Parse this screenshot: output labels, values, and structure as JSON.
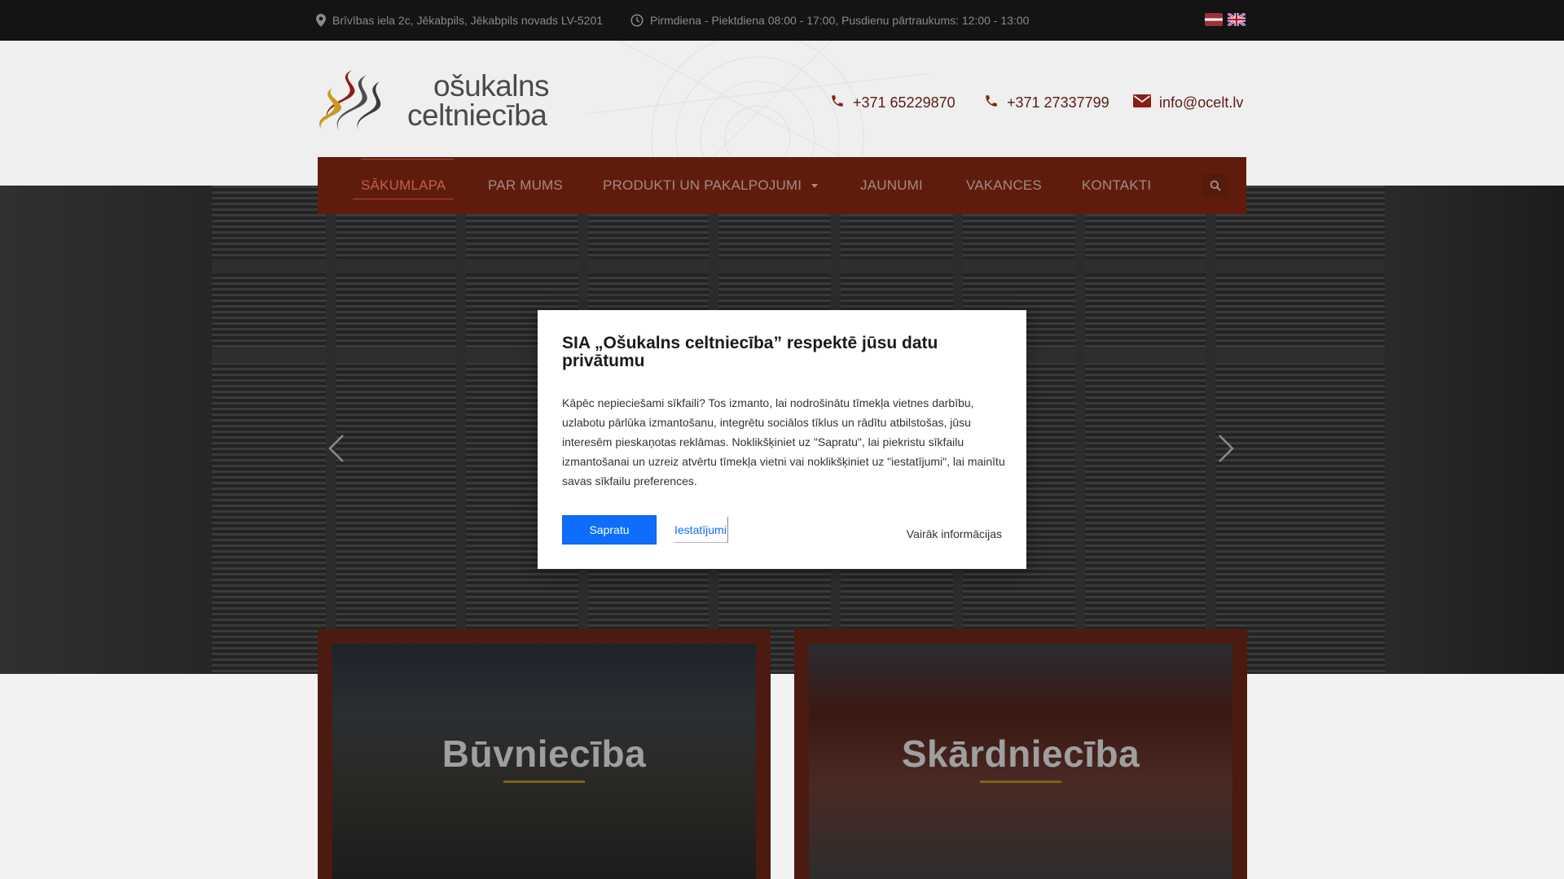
{
  "topbar": {
    "address": "Brīvības iela 2c, Jēkabpils, Jēkabpils novads LV-5201",
    "hours": "Pirmdiena - Piektdiena 08:00 - 17:00, Pusdienu pārtraukums: 12:00 - 13:00"
  },
  "logo": {
    "line1": "ošukalns",
    "line2": "celtniecība"
  },
  "contacts": {
    "phone1": "+371 65229870",
    "phone2": "+371 27337799",
    "email": "info@ocelt.lv"
  },
  "nav": {
    "items": [
      {
        "label": "SĀKUMLAPA"
      },
      {
        "label": "PAR MUMS"
      },
      {
        "label": "PRODUKTI UN PAKALPOJUMI"
      },
      {
        "label": "JAUNUMI"
      },
      {
        "label": "VAKANCES"
      },
      {
        "label": "KONTAKTI"
      }
    ]
  },
  "cards": [
    {
      "title": "Būvniecība"
    },
    {
      "title": "Skārdniecība"
    }
  ],
  "cookie_modal": {
    "title": "SIA „Ošukalns celtniecība” respektē jūsu datu privātumu",
    "body": "Kāpēc nepieciešami sīkfaili? Tos izmanto, lai nodrošinātu tīmekļa vietnes darbību, uzlabotu pārlūka izmantošanu, integrētu sociālos tīklus un rādītu atbilstošas, jūsu interesēm pieskaņotas reklāmas. Noklikšķiniet uz \"Sapratu\", lai piekristu sīkfailu izmantošanai un uzreiz atvērtu tīmekļa vietni vai noklikšķiniet uz \"iestatījumi\", lai mainītu savas sīkfailu preferences.",
    "accept_label": "Sapratu",
    "settings_label": "Iestatījumi",
    "more_label": "Vairāk informācijas"
  },
  "colors": {
    "nav_bg": "#5f1c0d",
    "accent": "#b3472e",
    "button_primary": "#0d6efd"
  }
}
